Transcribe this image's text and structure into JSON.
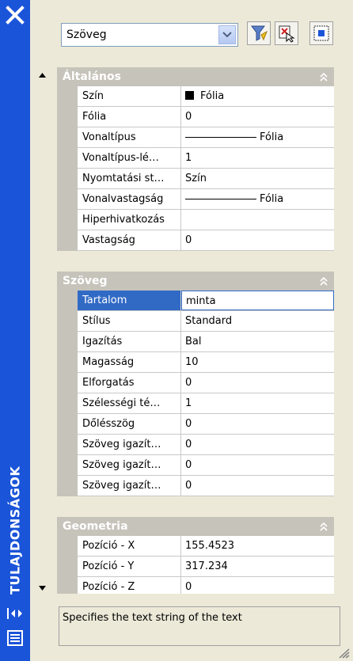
{
  "window": {
    "title": "TULAJDONSÁGOK"
  },
  "toolbar": {
    "object_type": "Szöveg"
  },
  "sections": [
    {
      "title": "Általános",
      "rows": [
        {
          "label": "Szín",
          "value": "Fólia"
        },
        {
          "label": "Fólia",
          "value": "0"
        },
        {
          "label": "Vonaltípus",
          "value": "Fólia"
        },
        {
          "label": "Vonaltípus-lé…",
          "value": "1"
        },
        {
          "label": "Nyomtatási st…",
          "value": "Szín"
        },
        {
          "label": "Vonalvastagság",
          "value": "Fólia"
        },
        {
          "label": "Hiperhivatkozás",
          "value": ""
        },
        {
          "label": "Vastagság",
          "value": "0"
        }
      ]
    },
    {
      "title": "Szöveg",
      "rows": [
        {
          "label": "Tartalom",
          "value": "minta"
        },
        {
          "label": "Stílus",
          "value": "Standard"
        },
        {
          "label": "Igazítás",
          "value": "Bal"
        },
        {
          "label": "Magasság",
          "value": "10"
        },
        {
          "label": "Elforgatás",
          "value": "0"
        },
        {
          "label": "Szélességi té…",
          "value": "1"
        },
        {
          "label": "Dőlésszög",
          "value": "0"
        },
        {
          "label": "Szöveg igazít…",
          "value": "0"
        },
        {
          "label": "Szöveg igazít…",
          "value": "0"
        },
        {
          "label": "Szöveg igazít…",
          "value": "0"
        }
      ]
    },
    {
      "title": "Geometria",
      "rows": [
        {
          "label": "Pozíció - X",
          "value": "155.4523"
        },
        {
          "label": "Pozíció - Y",
          "value": "317.234"
        },
        {
          "label": "Pozíció - Z",
          "value": "0"
        }
      ]
    }
  ],
  "description": "Specifies the text string of the text",
  "colors": {
    "titlebar": "#1a54d8",
    "selection": "#316ac5",
    "section_header": "#c6c3bb"
  }
}
